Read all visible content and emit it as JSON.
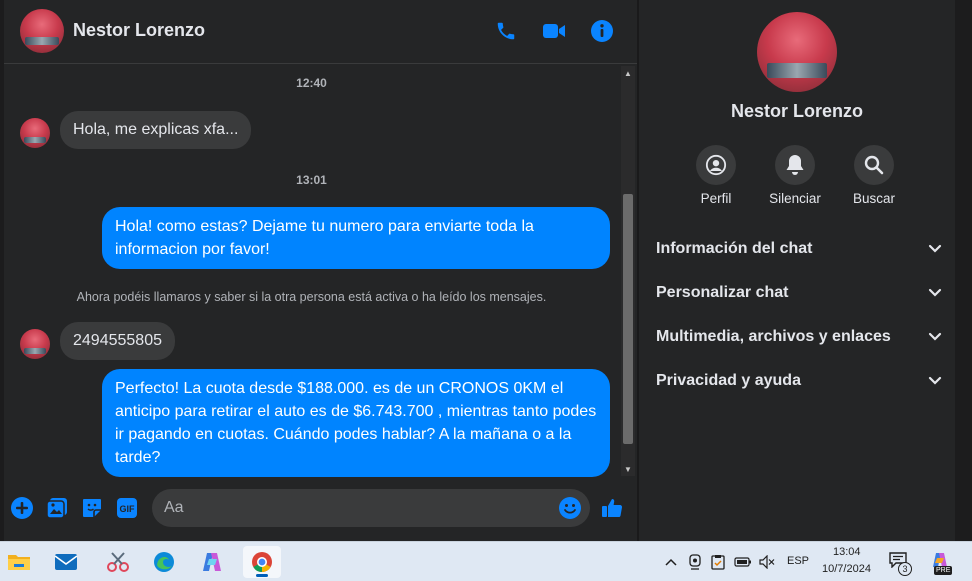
{
  "contact": {
    "name": "Nestor Lorenzo"
  },
  "header": {
    "icons": [
      "phone-icon",
      "video-icon",
      "info-icon"
    ]
  },
  "messages": {
    "time1": "12:40",
    "in1": "Hola, me explicas xfa...",
    "time2": "13:01",
    "out1": "Hola! como estas? Dejame tu numero para enviarte toda la informacion por favor!",
    "system_note": "Ahora podéis llamaros y saber si la otra persona está activa o ha leído los mensajes.",
    "in2": "2494555805",
    "out2": "Perfecto! La cuota desde $188.000. es de un CRONOS 0KM el anticipo para retirar el auto es de $6.743.700 , mientras tanto podes ir pagando en cuotas. Cuándo podes hablar? A la mañana o a la tarde?"
  },
  "composer": {
    "placeholder": "Aa",
    "icons": [
      "plus-icon",
      "image-icon",
      "sticker-icon",
      "gif-icon",
      "emoji-icon",
      "like-icon"
    ],
    "gif_label": "GIF"
  },
  "sidebar": {
    "actions": [
      {
        "label": "Perfil",
        "icon": "profile-icon"
      },
      {
        "label": "Silenciar",
        "icon": "bell-icon"
      },
      {
        "label": "Buscar",
        "icon": "search-icon"
      }
    ],
    "sections": [
      {
        "title": "Información del chat"
      },
      {
        "title": "Personalizar chat"
      },
      {
        "title": "Multimedia, archivos y enlaces"
      },
      {
        "title": "Privacidad y ayuda"
      }
    ]
  },
  "taskbar": {
    "apps": [
      "file-explorer-icon",
      "mail-icon",
      "snipping-tool-icon",
      "edge-icon",
      "copilot-icon",
      "chrome-icon"
    ],
    "language": "ESP",
    "time": "13:04",
    "date": "10/7/2024",
    "notification_count": "3",
    "copilot_badge": "PRE"
  },
  "colors": {
    "background": "#242526",
    "bubble_incoming": "#3a3b3c",
    "bubble_outgoing": "#0084ff",
    "accent": "#0084ff",
    "taskbar": "#dfe8f3"
  }
}
